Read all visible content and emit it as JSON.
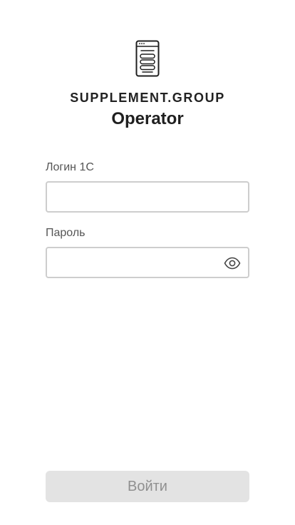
{
  "header": {
    "brand": "SUPPLEMENT.GROUP",
    "app_name": "Operator",
    "logo_icon": "document-list-icon"
  },
  "form": {
    "login_label": "Логин 1С",
    "login_value": "",
    "login_placeholder": "",
    "password_label": "Пароль",
    "password_value": "",
    "password_placeholder": "",
    "password_toggle_icon": "eye-icon",
    "submit_label": "Войти",
    "submit_disabled": true
  },
  "colors": {
    "text": "#1f1f1f",
    "label": "#555555",
    "input_border": "#cdcdcd",
    "button_bg_disabled": "#e3e3e3",
    "button_text_disabled": "#8f8f8f"
  }
}
